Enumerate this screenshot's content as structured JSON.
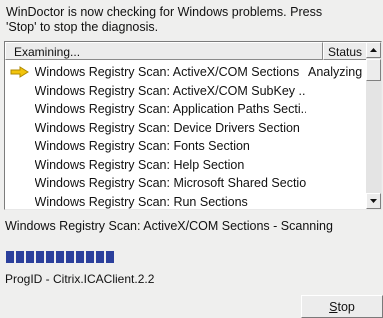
{
  "intro": {
    "line1": "WinDoctor is now checking for Windows problems.  Press",
    "line2": "'Stop' to stop the diagnosis."
  },
  "list": {
    "columns": [
      "Examining...",
      "Status"
    ],
    "rows": [
      {
        "name": "Windows Registry Scan: ActiveX/COM Sections",
        "status": "Analyzing",
        "current": true
      },
      {
        "name": "Windows Registry Scan: ActiveX/COM SubKey ...",
        "status": "",
        "current": false
      },
      {
        "name": "Windows Registry Scan: Application Paths Secti...",
        "status": "",
        "current": false
      },
      {
        "name": "Windows Registry Scan: Device Drivers Section",
        "status": "",
        "current": false
      },
      {
        "name": "Windows Registry Scan: Fonts Section",
        "status": "",
        "current": false
      },
      {
        "name": "Windows Registry Scan: Help Section",
        "status": "",
        "current": false
      },
      {
        "name": "Windows Registry Scan: Microsoft Shared Section",
        "status": "",
        "current": false
      },
      {
        "name": "Windows Registry Scan: Run Sections",
        "status": "",
        "current": false
      }
    ]
  },
  "scan_status": "Windows Registry Scan: ActiveX/COM Sections - Scanning",
  "progress": {
    "filled_blocks": 11
  },
  "progid": "ProgID - Citrix.ICAClient.2.2",
  "stop_button": {
    "first": "S",
    "rest": "top"
  },
  "colors": {
    "progress": "#2b3f9c",
    "arrow": "#f2c40c"
  }
}
